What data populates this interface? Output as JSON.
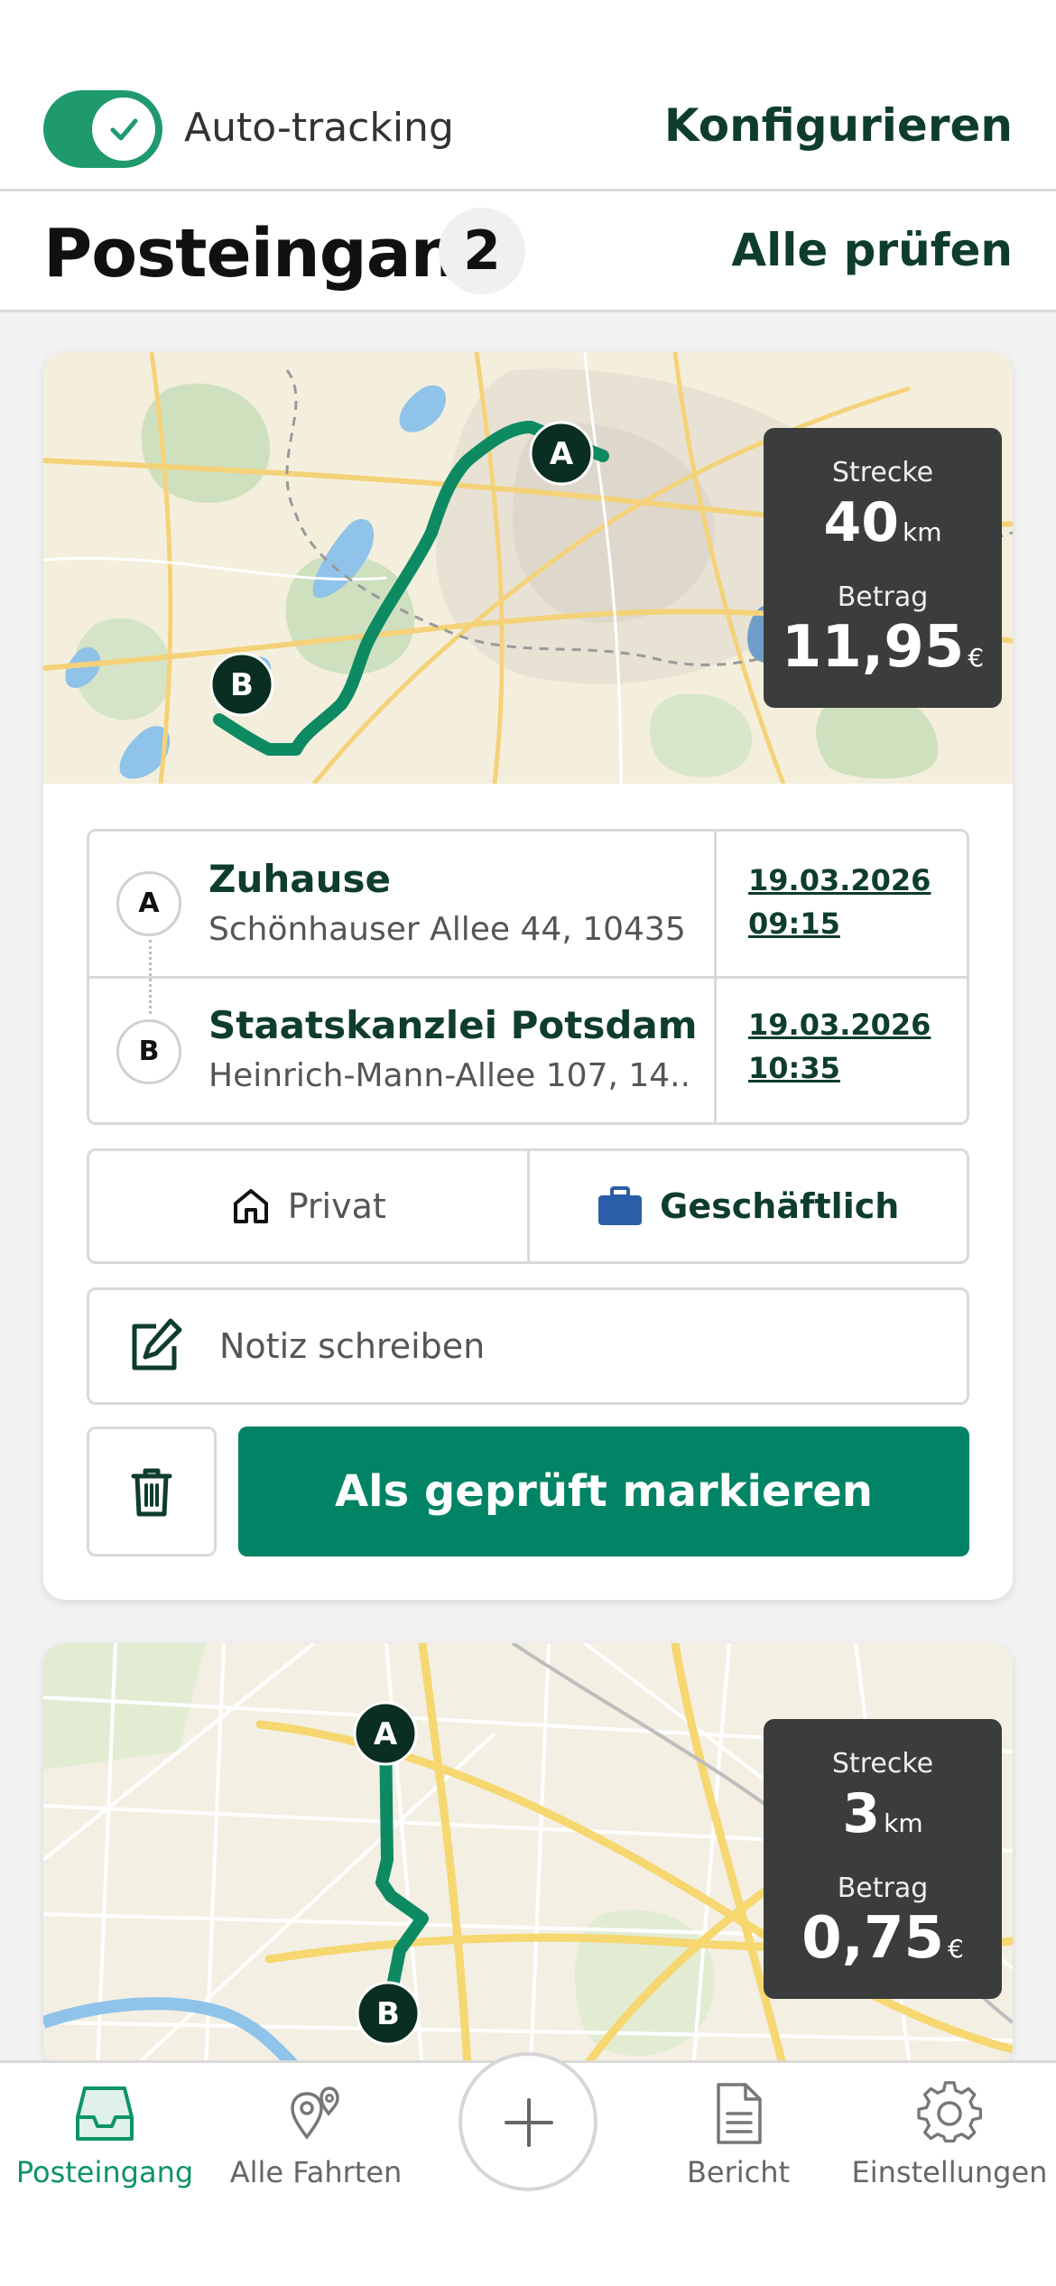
{
  "topbar": {
    "auto_tracking_label": "Auto-tracking",
    "auto_tracking_on": true,
    "configure_label": "Konfigurieren"
  },
  "inbox": {
    "title": "Posteingang",
    "count": "2",
    "check_all_label": "Alle prüfen"
  },
  "trips": [
    {
      "distance_label": "Strecke",
      "distance_value": "40",
      "distance_unit": "km",
      "amount_label": "Betrag",
      "amount_value": "11,95",
      "amount_unit": "€",
      "start": {
        "marker": "A",
        "name": "Zuhause",
        "address": "Schönhauser Allee 44, 10435...",
        "date": "19.03.2026",
        "time": "09:15"
      },
      "end": {
        "marker": "B",
        "name": "Staatskanzlei Potsdam",
        "address": "Heinrich-Mann-Allee 107, 14...",
        "date": "19.03.2026",
        "time": "10:35"
      },
      "type_private_label": "Privat",
      "type_business_label": "Geschäftlich",
      "selected_type": "business",
      "note_placeholder": "Notiz schreiben",
      "mark_checked_label": "Als geprüft markieren"
    },
    {
      "distance_label": "Strecke",
      "distance_value": "3",
      "distance_unit": "km",
      "amount_label": "Betrag",
      "amount_value": "0,75",
      "amount_unit": "€",
      "start": {
        "marker": "A"
      },
      "end": {
        "marker": "B"
      }
    }
  ],
  "nav": {
    "items": [
      {
        "label": "Posteingang",
        "icon": "inbox-tray-icon",
        "active": true
      },
      {
        "label": "Alle Fahrten",
        "icon": "map-pins-icon",
        "active": false
      },
      {
        "label": "Bericht",
        "icon": "document-icon",
        "active": false
      },
      {
        "label": "Einstellungen",
        "icon": "gear-icon",
        "active": false
      }
    ],
    "add_icon": "plus-icon"
  },
  "colors": {
    "accent": "#008465",
    "brand_dark": "#0f3d2c",
    "toggle_on": "#1f9a6c",
    "route_line": "#0e8a63",
    "business_icon": "#2b5ea8",
    "stat_box": "#3a3d3b"
  }
}
